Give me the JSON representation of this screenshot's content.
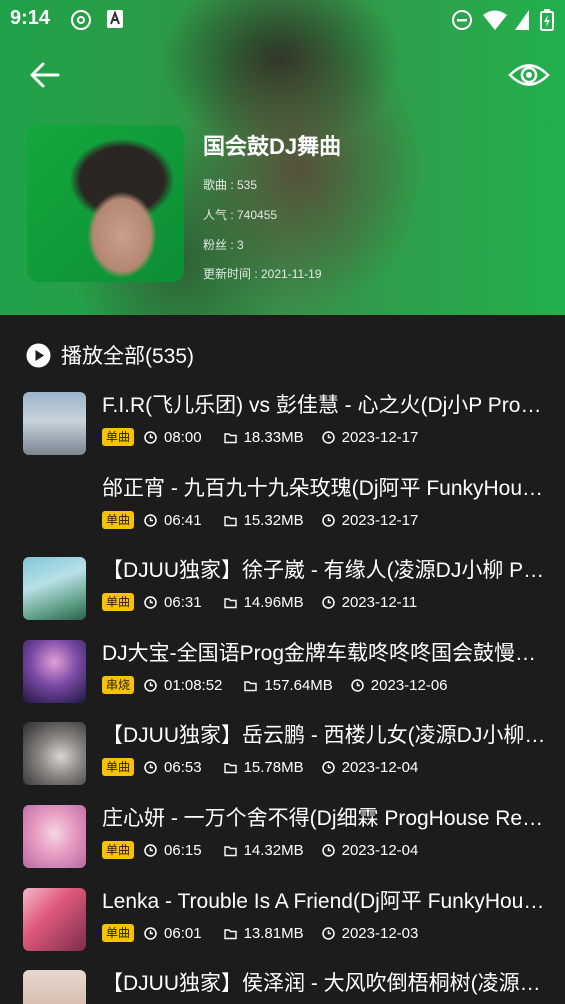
{
  "status_bar": {
    "time": "9:14"
  },
  "playlist": {
    "title": "国会鼓DJ舞曲",
    "songs_line": "歌曲 : 535",
    "popularity_line": "人气 : 740455",
    "fans_line": "粉丝 : 3",
    "updated_line": "更新时间 : 2021-11-19"
  },
  "play_all": {
    "label": "播放全部(535)"
  },
  "songs": [
    {
      "title": "F.I.R(飞儿乐团) vs 彭佳慧 - 心之火(Dj小P ProgHouse Remix)",
      "tag": "单曲",
      "duration": "08:00",
      "size": "18.33MB",
      "date": "2023-12-17"
    },
    {
      "title": "邰正宵 - 九百九十九朵玫瑰(Dj阿平 FunkyHouse Remix)",
      "tag": "单曲",
      "duration": "06:41",
      "size": "15.32MB",
      "date": "2023-12-17"
    },
    {
      "title": "【DJUU独家】徐子崴 - 有缘人(凌源DJ小柳 ProgHouse Remix)",
      "tag": "单曲",
      "duration": "06:31",
      "size": "14.96MB",
      "date": "2023-12-11"
    },
    {
      "title": "DJ大宝-全国语Prog金牌车载咚咚咚国会鼓慢摇串烧",
      "tag": "串烧",
      "duration": "01:08:52",
      "size": "157.64MB",
      "date": "2023-12-06"
    },
    {
      "title": "【DJUU独家】岳云鹏 - 西楼儿女(凌源DJ小柳 ProgHouse Remix)",
      "tag": "单曲",
      "duration": "06:53",
      "size": "15.78MB",
      "date": "2023-12-04"
    },
    {
      "title": "庄心妍 - 一万个舍不得(Dj细霖 ProgHouse Remix)",
      "tag": "单曲",
      "duration": "06:15",
      "size": "14.32MB",
      "date": "2023-12-04"
    },
    {
      "title": "Lenka - Trouble Is A Friend(Dj阿平 FunkyHouse Remix)",
      "tag": "单曲",
      "duration": "06:01",
      "size": "13.81MB",
      "date": "2023-12-03"
    },
    {
      "title": "【DJUU独家】侯泽润 - 大风吹倒梧桐树(凌源DJ小柳 Remix)"
    }
  ]
}
